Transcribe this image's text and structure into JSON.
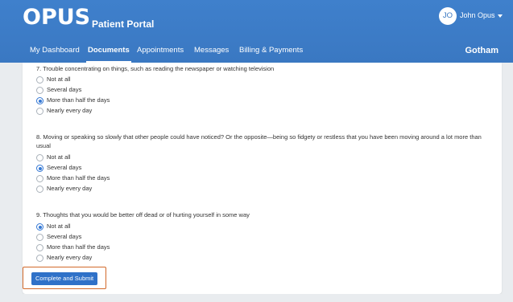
{
  "header": {
    "logo": "OPUS",
    "portal_title": "Patient Portal",
    "avatar_initials": "JO",
    "user_name": "John Opus",
    "org_name": "Gotham"
  },
  "nav": {
    "items": [
      "My Dashboard",
      "Documents",
      "Appointments",
      "Messages",
      "Billing & Payments"
    ],
    "active": "Documents"
  },
  "questions": [
    {
      "text": "7. Trouble concentrating on things, such as reading the newspaper or watching television",
      "options": [
        "Not at all",
        "Several days",
        "More than half the days",
        "Nearly every day"
      ],
      "selected": "More than half the days"
    },
    {
      "text": "8. Moving or speaking so slowly that other people could have noticed? Or the opposite—being so fidgety or restless that you have been moving around a lot more than usual",
      "options": [
        "Not at all",
        "Several days",
        "More than half the days",
        "Nearly every day"
      ],
      "selected": "Several days"
    },
    {
      "text": "9. Thoughts that you would be better off dead or of hurting yourself in some way",
      "options": [
        "Not at all",
        "Several days",
        "More than half the days",
        "Nearly every day"
      ],
      "selected": "Not at all"
    }
  ],
  "submit_label": "Complete and Submit",
  "colors": {
    "header": "#3a78c2",
    "accent": "#3478d4",
    "highlight_border": "#d2692a"
  }
}
